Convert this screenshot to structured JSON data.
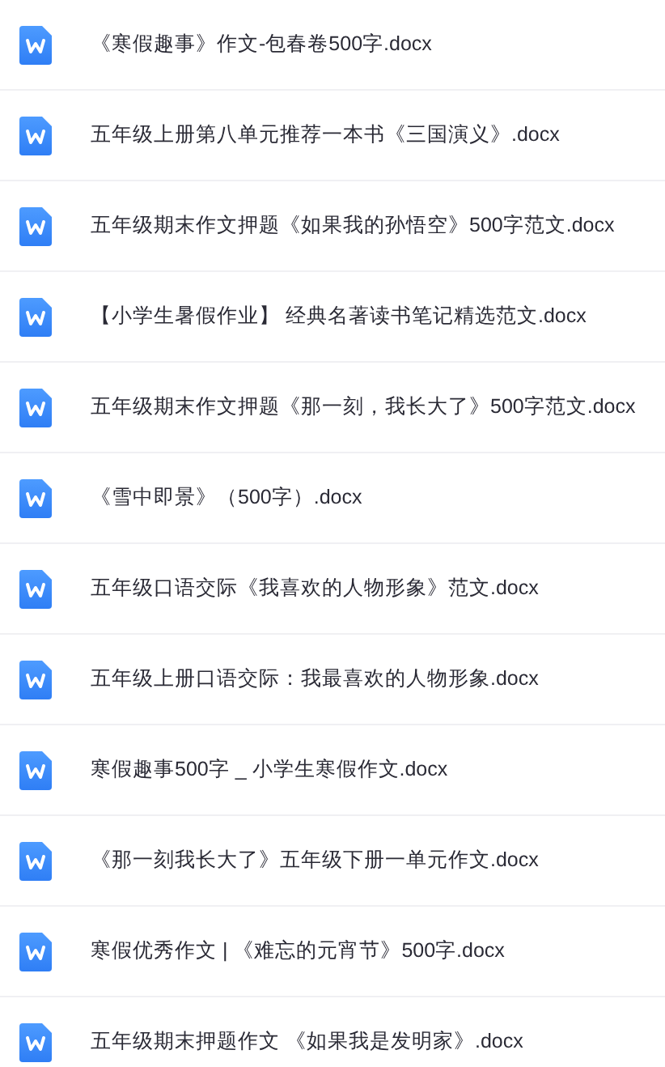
{
  "files": [
    {
      "name": "《寒假趣事》作文-包春卷500字.docx"
    },
    {
      "name": "五年级上册第八单元推荐一本书《三国演义》.docx"
    },
    {
      "name": "五年级期末作文押题《如果我的孙悟空》500字范文.docx"
    },
    {
      "name": "【小学生暑假作业】 经典名著读书笔记精选范文.docx"
    },
    {
      "name": "五年级期末作文押题《那一刻，我长大了》500字范文.docx"
    },
    {
      "name": "《雪中即景》（500字）.docx"
    },
    {
      "name": "五年级口语交际《我喜欢的人物形象》范文.docx"
    },
    {
      "name": "五年级上册口语交际：我最喜欢的人物形象.docx"
    },
    {
      "name": "寒假趣事500字 _ 小学生寒假作文.docx"
    },
    {
      "name": "《那一刻我长大了》五年级下册一单元作文.docx"
    },
    {
      "name": "寒假优秀作文 | 《难忘的元宵节》500字.docx"
    },
    {
      "name": "五年级期末押题作文 《如果我是发明家》.docx"
    }
  ]
}
